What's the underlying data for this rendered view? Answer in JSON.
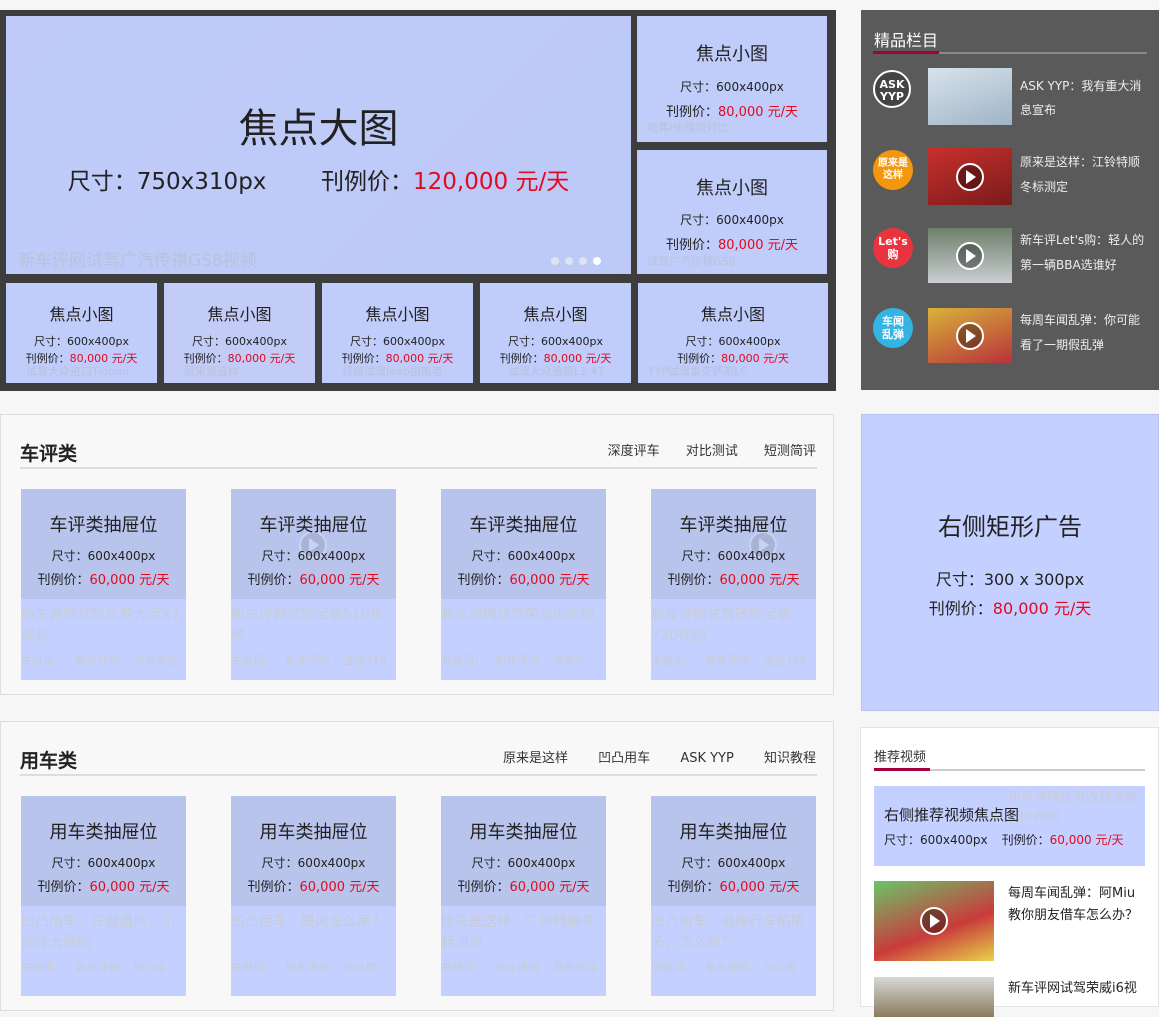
{
  "focus": {
    "big": {
      "title": "焦点大图",
      "size_label": "尺寸：750x310px",
      "price_label": "刊例价：",
      "price": "120,000 元/天",
      "caption": "新车评网试驾广汽传祺GS8视频"
    },
    "right_small": [
      {
        "title": "焦点小图",
        "size": "尺寸：600x400px",
        "price_label": "刊例价：",
        "price": "80,000 元/天",
        "caption": "哈弗H6横向对比"
      },
      {
        "title": "焦点小图",
        "size": "尺寸：600x400px",
        "price_label": "刊例价：",
        "price": "80,000 元/天",
        "caption": "试驾广汽传祺GS8"
      }
    ],
    "bottom_small": [
      {
        "title": "焦点小图",
        "size": "尺寸：600x400px",
        "price_label": "刊例价：",
        "price": "80,000 元/天",
        "caption": "试驾大众进口Tiguan"
      },
      {
        "title": "焦点小图",
        "size": "尺寸：600x400px",
        "price_label": "刊例价：",
        "price": "80,000 元/天",
        "caption": "原来是这样"
      },
      {
        "title": "焦点小图",
        "size": "尺寸：600x400px",
        "price_label": "刊例价：",
        "price": "80,000 元/天",
        "caption": "视频试驾Jeep指南者"
      },
      {
        "title": "焦点小图",
        "size": "尺寸：600x400px",
        "price_label": "刊例价：",
        "price": "80,000 元/天",
        "caption": "试驾大众途观L1.4T"
      },
      {
        "title": "焦点小图",
        "size": "尺寸：600x400px",
        "price_label": "刊例价：",
        "price": "80,000 元/天",
        "caption": "YYP试驾雷克萨斯LC"
      }
    ]
  },
  "featured": {
    "title": "精品栏目",
    "items": [
      {
        "badge": "ASK YYP",
        "text": "ASK YYP：我有重大消息宣布"
      },
      {
        "badge": "原来是这样",
        "text": "原来是这样：江铃特顺冬标测定"
      },
      {
        "badge": "Let's购",
        "text": "新车评Let's购：轻人的第一辆BBA选谁好"
      },
      {
        "badge": "车闻乱弹",
        "text": "每周车闻乱弹：你可能看了一期假乱弹"
      }
    ]
  },
  "review": {
    "title": "车评类",
    "links": [
      "深度评车",
      "对比测试",
      "短测简评"
    ],
    "cards": [
      {
        "title": "车评类抽屉位",
        "size": "尺寸：600x400px",
        "price_label": "刊例价：",
        "price": "60,000 元/天",
        "caption": "新车评网试驾众泰大迈X7视频",
        "keywords": "关键词：   新车评网    众泰大迈"
      },
      {
        "title": "车评类抽屉位",
        "size": "尺寸：600x400px",
        "price_label": "刊例价：",
        "price": "60,000 元/天",
        "caption": "新车评网试驾宝骏510视频",
        "keywords": "关键词：   新车评网    宝骏510"
      },
      {
        "title": "车评类抽屉位",
        "size": "尺寸：600x400px",
        "price_label": "刊例价：",
        "price": "60,000 元/天",
        "caption": "新车评网试驾荣威i6视频",
        "keywords": "关键词：   新车评网    荣威i6"
      },
      {
        "title": "车评类抽屉位",
        "size": "尺寸：600x400px",
        "price_label": "刊例价：",
        "price": "60,000 元/天",
        "caption": "新车评网试驾改款宝骏730视频",
        "keywords": "关键词：   新车评网    宝骏730"
      }
    ]
  },
  "usage": {
    "title": "用车类",
    "links": [
      "原来是这样",
      "凹凸用车",
      "ASK YYP",
      "知识教程"
    ],
    "cards": [
      {
        "title": "用车类抽屉位",
        "size": "尺寸：600x400px",
        "price_label": "刊例价：",
        "price": "60,000 元/天",
        "caption": "凹凸用车：开窗通风，小动作大影响",
        "keywords": "关键词：   新车评网    凹凸用"
      },
      {
        "title": "用车类抽屉位",
        "size": "尺寸：600x400px",
        "price_label": "刊例价：",
        "price": "60,000 元/天",
        "caption": "凹凸用车：暖风怎么用？",
        "keywords": "关键词：   新车评网    凹凸用"
      },
      {
        "title": "用车类抽屉位",
        "size": "尺寸：600x400px",
        "price_label": "刊例价：",
        "price": "60,000 元/天",
        "caption": "原来是这样：江铃特顺冬标测定",
        "keywords": "关键词：   新车评网    原来是这"
      },
      {
        "title": "用车类抽屉位",
        "size": "尺寸：600x400px",
        "price_label": "刊例价：",
        "price": "60,000 元/天",
        "caption": "凹凸用车：地库行车陷阱多，怎么破？",
        "keywords": "关键词：   新车评网    凹凸用"
      }
    ]
  },
  "right_ad": {
    "title": "右侧矩形广告",
    "size": "尺寸：300 x 300px",
    "price_label": "刊例价：",
    "price": "80,000 元/天"
  },
  "recommend": {
    "title": "推荐视频",
    "focus": {
      "title": "右侧推荐视频焦点图",
      "size": "尺寸：600x400px",
      "price_label": "刊例价：",
      "price": "60,000 元/天",
      "caption": "新车评网试驾改款宝骏730视频"
    },
    "items": [
      {
        "text": "每周车闻乱弹：阿Miu教你朋友借车怎么办？"
      },
      {
        "text": "新车评网试驾荣威i6视"
      }
    ]
  },
  "colors": {
    "price_red": "#e3091e",
    "overlay_blue": "#c4d0ff",
    "dark_panel": "#5a5a5a",
    "accent_crimson": "#a0003c"
  }
}
